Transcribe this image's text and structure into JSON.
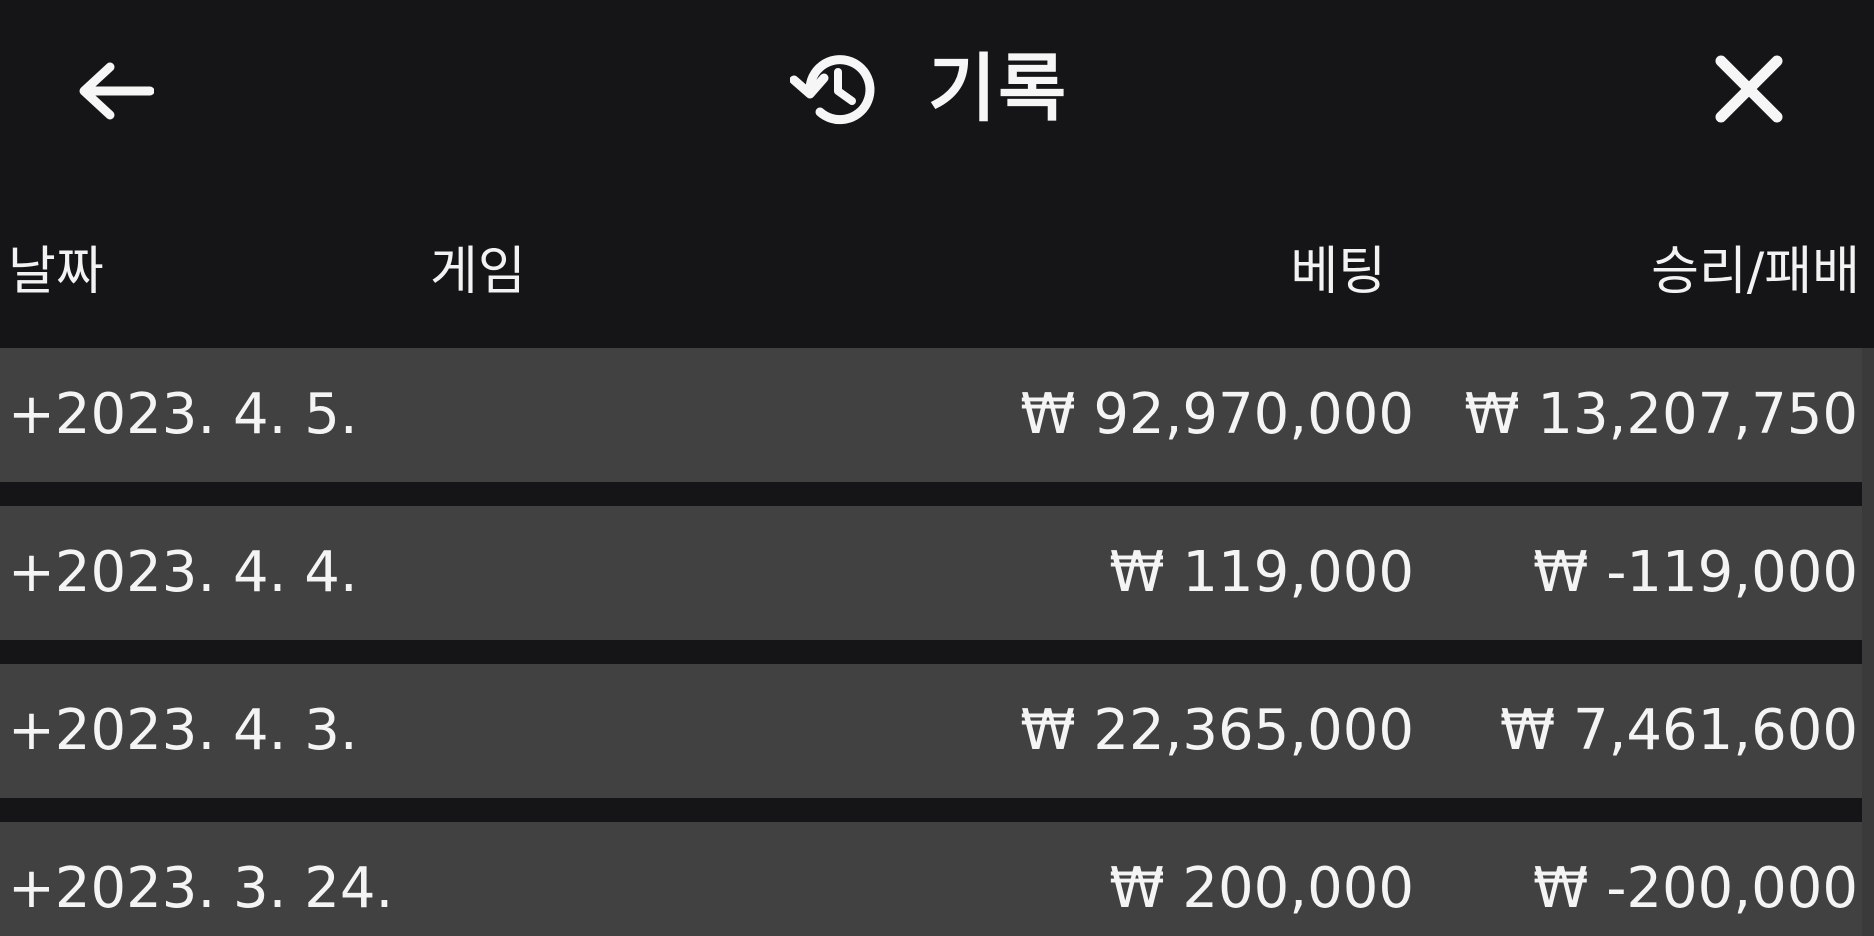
{
  "header": {
    "title": "기록",
    "back_icon": "arrow-left-icon",
    "history_icon": "history-icon",
    "close_icon": "close-icon"
  },
  "columns": {
    "date": "날짜",
    "game": "게임",
    "bet": "베팅",
    "win_loss": "승리/패배"
  },
  "rows": [
    {
      "date": "+2023. 4. 5.",
      "game": "",
      "bet": "₩ 92,970,000",
      "win_loss": "₩ 13,207,750"
    },
    {
      "date": "+2023. 4. 4.",
      "game": "",
      "bet": "₩ 119,000",
      "win_loss": "₩ -119,000"
    },
    {
      "date": "+2023. 4. 3.",
      "game": "",
      "bet": "₩ 22,365,000",
      "win_loss": "₩ 7,461,600"
    },
    {
      "date": "+2023. 3. 24.",
      "game": "",
      "bet": "₩ 200,000",
      "win_loss": "₩ -200,000"
    }
  ],
  "colors": {
    "background": "#151517",
    "row_background": "#414142",
    "text": "#f4f4f4"
  }
}
